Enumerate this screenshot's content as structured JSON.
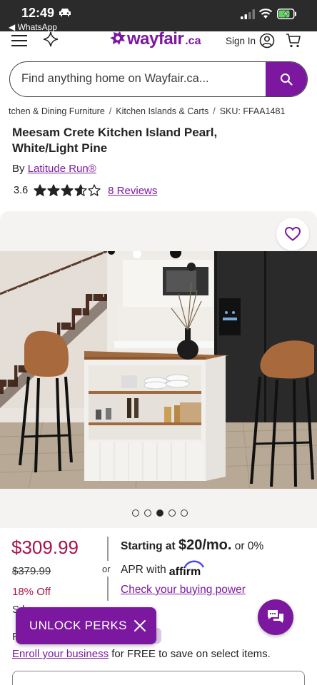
{
  "status_bar": {
    "time": "12:49",
    "back_app": "◀ WhatsApp"
  },
  "header": {
    "logo_text": "wayfair",
    "logo_tld": ".ca",
    "sign_in": "Sign In"
  },
  "search": {
    "placeholder": "Find anything home on Wayfair.ca..."
  },
  "breadcrumb": {
    "items": [
      "tchen & Dining Furniture",
      "Kitchen Islands & Carts"
    ],
    "separator": "/",
    "sku": "SKU: FFAA1481"
  },
  "product": {
    "title": "Meesam Crete Kitchen Island Pearl, White/Light Pine",
    "brand_prefix": "By",
    "brand": "Latitude Run®",
    "rating": "3.6",
    "rating_value": 3.6,
    "rating_max": 5,
    "reviews": "8 Reviews"
  },
  "carousel": {
    "count": 5,
    "active_index": 2
  },
  "pricing": {
    "price": "$309.99",
    "list_price": "$379.99",
    "discount": "18% Off",
    "sale_partial": "S.l",
    "or": "or"
  },
  "financing": {
    "starting_at": "Starting at",
    "monthly": "$20/mo.",
    "or_zero": "or 0%",
    "apr_with": "APR with",
    "affirm": "affirm",
    "buying_power": "Check your buying power"
  },
  "perks": {
    "label": "UNLOCK PERKS",
    "partial_f": "F"
  },
  "enroll": {
    "link": "Enroll your business",
    "text": "for FREE to save on select items."
  },
  "colors": {
    "brand_purple": "#7b189f",
    "price_red": "#a8124a",
    "status_bar": "#2b2b2b",
    "battery_green": "#5fd35f"
  },
  "icons": [
    "car-icon",
    "signal-icon",
    "wifi-icon",
    "battery-icon",
    "menu-icon",
    "sparkle-icon",
    "account-icon",
    "cart-icon",
    "search-icon",
    "heart-icon",
    "close-icon",
    "chat-icon"
  ]
}
